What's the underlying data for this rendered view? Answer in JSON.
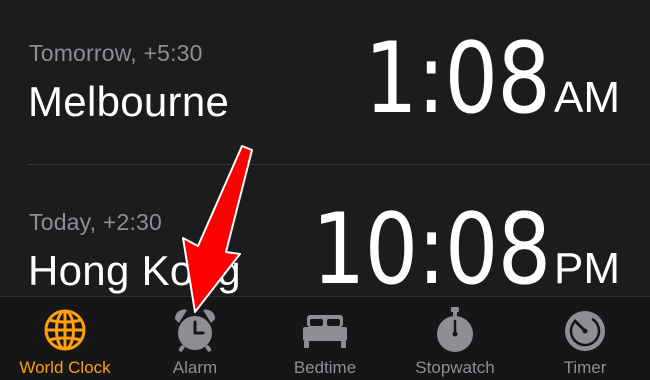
{
  "clocks": [
    {
      "offset": "Tomorrow, +5:30",
      "city": "Melbourne",
      "time": "1:08",
      "ampm": "AM"
    },
    {
      "offset": "Today, +2:30",
      "city": "Hong Kong",
      "time": "10:08",
      "ampm": "PM"
    }
  ],
  "tabs": [
    {
      "label": "World Clock",
      "icon": "globe-icon",
      "active": true
    },
    {
      "label": "Alarm",
      "icon": "alarm-clock-icon",
      "active": false
    },
    {
      "label": "Bedtime",
      "icon": "bed-icon",
      "active": false
    },
    {
      "label": "Stopwatch",
      "icon": "stopwatch-icon",
      "active": false
    },
    {
      "label": "Timer",
      "icon": "timer-icon",
      "active": false
    }
  ],
  "colors": {
    "background": "#1c1c1e",
    "tab_bar": "#161618",
    "active_tab": "#ff9f0a",
    "inactive_tab": "#8e8e93",
    "secondary_text": "#8e8e93",
    "annotation_arrow": "#ff0000"
  }
}
